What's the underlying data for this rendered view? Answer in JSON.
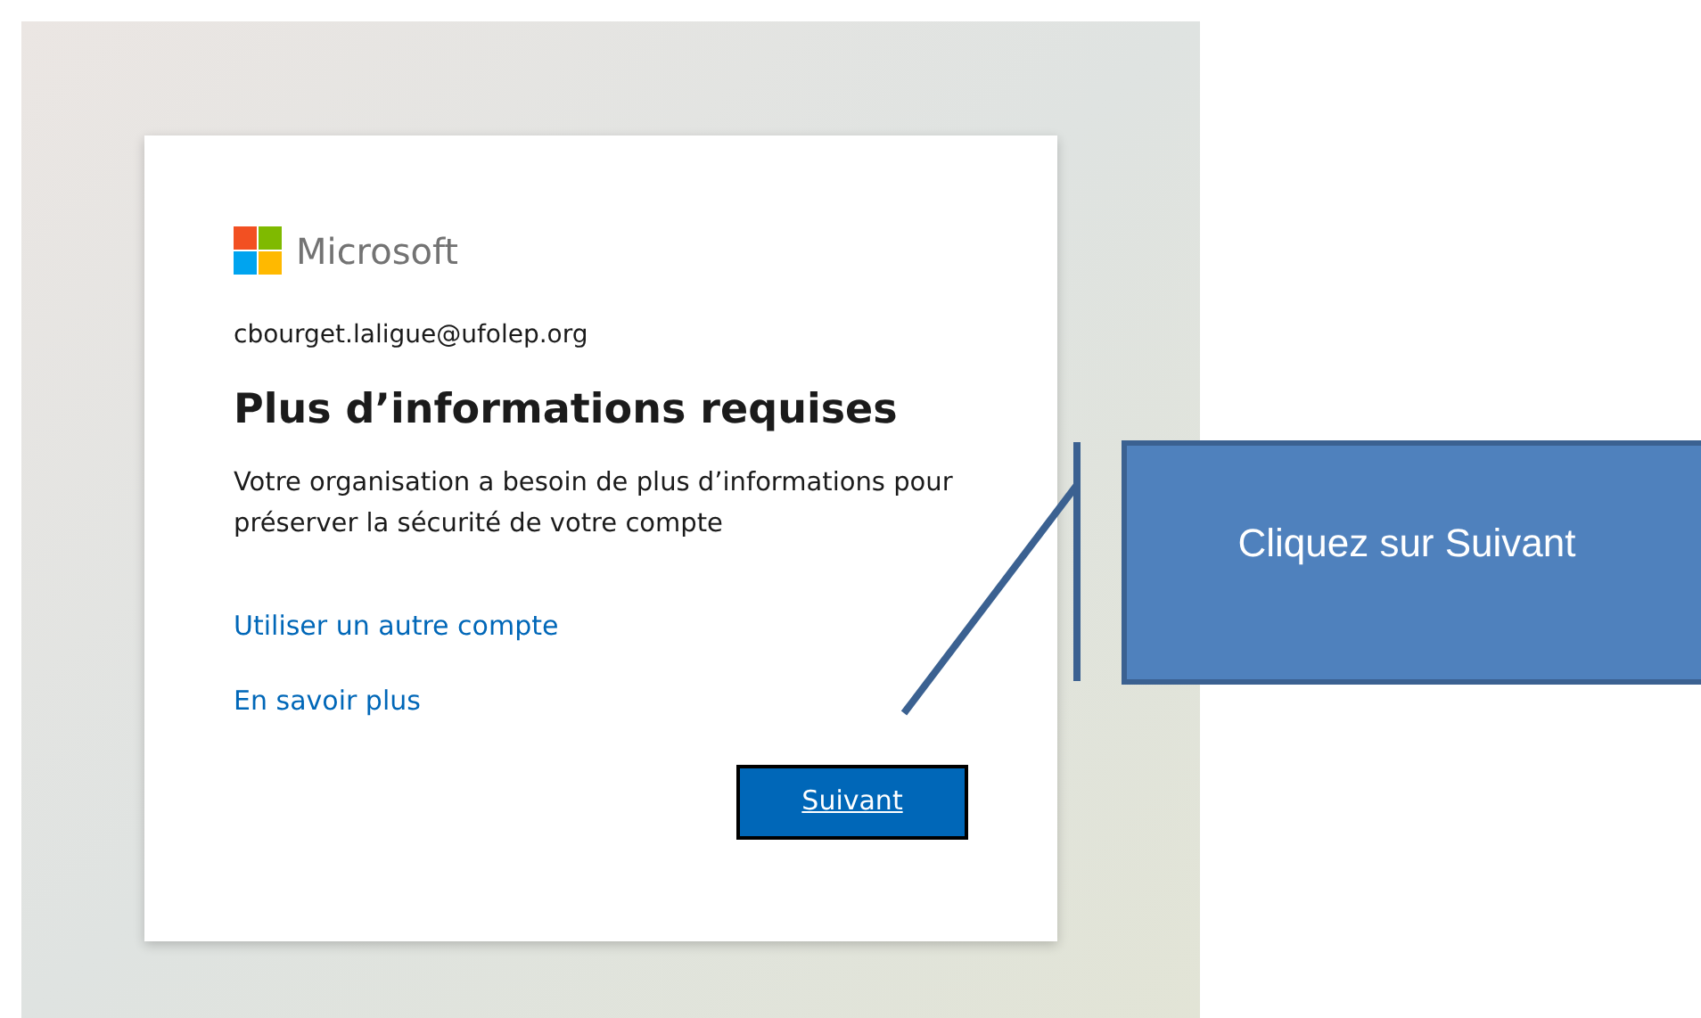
{
  "card": {
    "brand": "Microsoft",
    "email": "cbourget.laligue@ufolep.org",
    "title": "Plus d’informations requises",
    "message": "Votre organisation a besoin de plus d’informations pour préserver la sécurité de votre compte",
    "links": [
      "Utiliser un autre compte",
      "En savoir plus"
    ],
    "button": {
      "label": "Suivant",
      "highlighted": true
    }
  },
  "callout": {
    "text": "Cliquez sur Suivant"
  }
}
